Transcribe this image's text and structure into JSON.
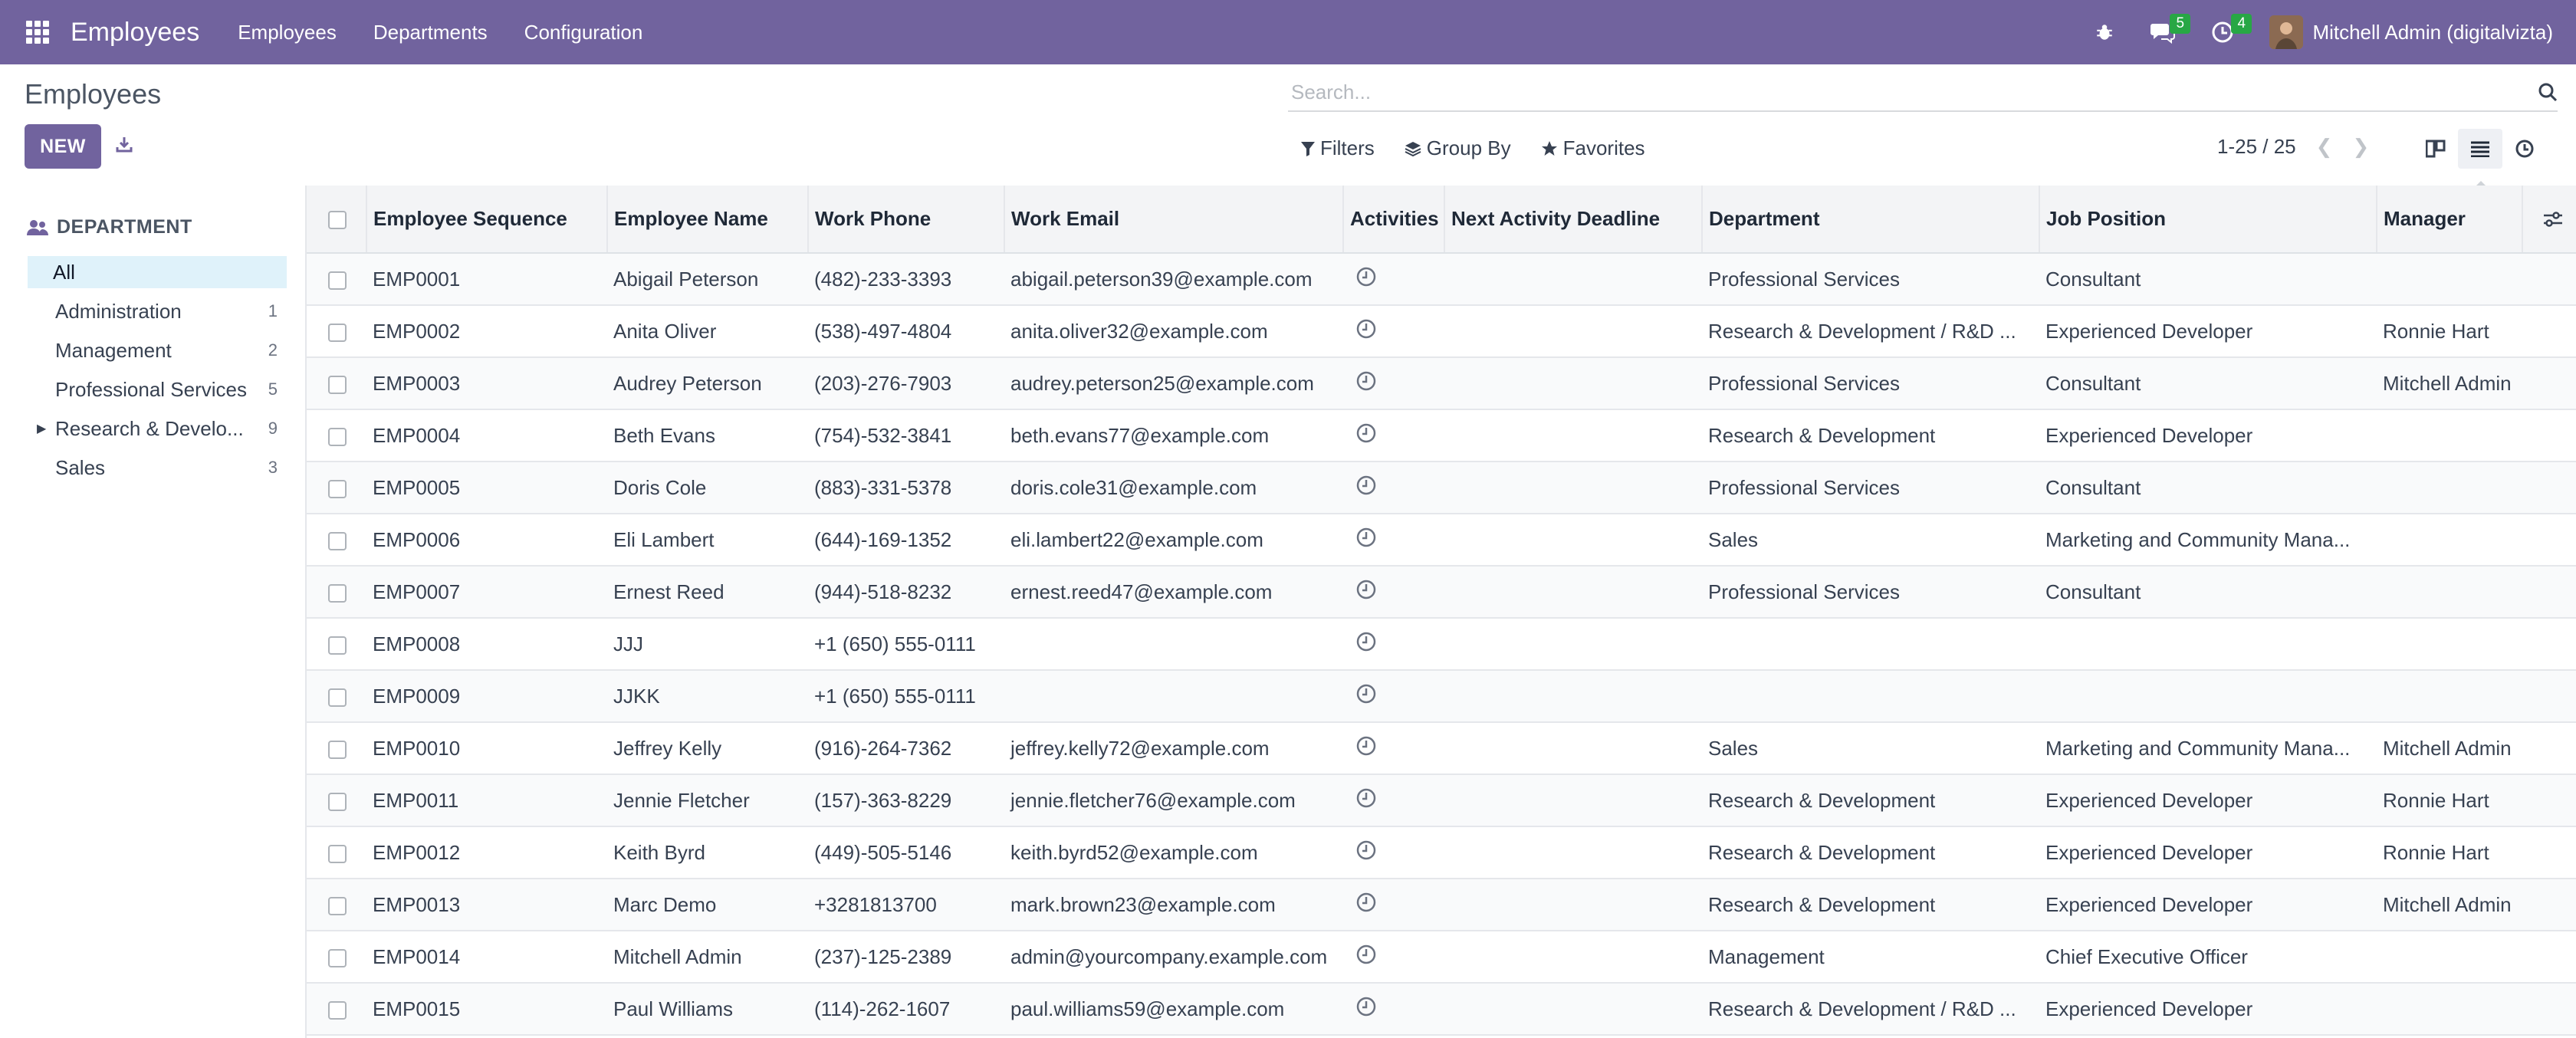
{
  "app": {
    "title": "Employees",
    "menu": [
      "Employees",
      "Departments",
      "Configuration"
    ],
    "user": "Mitchell Admin (digitalvizta)",
    "messages_badge": "5",
    "activities_badge": "4"
  },
  "control": {
    "page_title": "Employees",
    "search_placeholder": "Search...",
    "new_label": "NEW",
    "filters_label": "Filters",
    "groupby_label": "Group By",
    "favorites_label": "Favorites",
    "pager": "1-25 / 25",
    "tooltip": "List"
  },
  "sidebar": {
    "title": "DEPARTMENT",
    "items": [
      {
        "label": "All",
        "count": ""
      },
      {
        "label": "Administration",
        "count": "1"
      },
      {
        "label": "Management",
        "count": "2"
      },
      {
        "label": "Professional Services",
        "count": "5"
      },
      {
        "label": "Research & Develo...",
        "count": "9"
      },
      {
        "label": "Sales",
        "count": "3"
      }
    ]
  },
  "table": {
    "columns": [
      "Employee Sequence",
      "Employee Name",
      "Work Phone",
      "Work Email",
      "Activities",
      "Next Activity Deadline",
      "Department",
      "Job Position",
      "Manager"
    ],
    "rows": [
      {
        "seq": "EMP0001",
        "name": "Abigail Peterson",
        "phone": "(482)-233-3393",
        "email": "abigail.peterson39@example.com",
        "deadline": "",
        "dept": "Professional Services",
        "job": "Consultant",
        "manager": ""
      },
      {
        "seq": "EMP0002",
        "name": "Anita Oliver",
        "phone": "(538)-497-4804",
        "email": "anita.oliver32@example.com",
        "deadline": "",
        "dept": "Research & Development / R&D ...",
        "job": "Experienced Developer",
        "manager": "Ronnie Hart"
      },
      {
        "seq": "EMP0003",
        "name": "Audrey Peterson",
        "phone": "(203)-276-7903",
        "email": "audrey.peterson25@example.com",
        "deadline": "",
        "dept": "Professional Services",
        "job": "Consultant",
        "manager": "Mitchell Admin"
      },
      {
        "seq": "EMP0004",
        "name": "Beth Evans",
        "phone": "(754)-532-3841",
        "email": "beth.evans77@example.com",
        "deadline": "",
        "dept": "Research & Development",
        "job": "Experienced Developer",
        "manager": ""
      },
      {
        "seq": "EMP0005",
        "name": "Doris Cole",
        "phone": "(883)-331-5378",
        "email": "doris.cole31@example.com",
        "deadline": "",
        "dept": "Professional Services",
        "job": "Consultant",
        "manager": ""
      },
      {
        "seq": "EMP0006",
        "name": "Eli Lambert",
        "phone": "(644)-169-1352",
        "email": "eli.lambert22@example.com",
        "deadline": "",
        "dept": "Sales",
        "job": "Marketing and Community Mana...",
        "manager": ""
      },
      {
        "seq": "EMP0007",
        "name": "Ernest Reed",
        "phone": "(944)-518-8232",
        "email": "ernest.reed47@example.com",
        "deadline": "",
        "dept": "Professional Services",
        "job": "Consultant",
        "manager": ""
      },
      {
        "seq": "EMP0008",
        "name": "JJJ",
        "phone": "+1 (650) 555-0111",
        "email": "",
        "deadline": "",
        "dept": "",
        "job": "",
        "manager": ""
      },
      {
        "seq": "EMP0009",
        "name": "JJKK",
        "phone": "+1 (650) 555-0111",
        "email": "",
        "deadline": "",
        "dept": "",
        "job": "",
        "manager": ""
      },
      {
        "seq": "EMP0010",
        "name": "Jeffrey Kelly",
        "phone": "(916)-264-7362",
        "email": "jeffrey.kelly72@example.com",
        "deadline": "",
        "dept": "Sales",
        "job": "Marketing and Community Mana...",
        "manager": "Mitchell Admin"
      },
      {
        "seq": "EMP0011",
        "name": "Jennie Fletcher",
        "phone": "(157)-363-8229",
        "email": "jennie.fletcher76@example.com",
        "deadline": "",
        "dept": "Research & Development",
        "job": "Experienced Developer",
        "manager": "Ronnie Hart"
      },
      {
        "seq": "EMP0012",
        "name": "Keith Byrd",
        "phone": "(449)-505-5146",
        "email": "keith.byrd52@example.com",
        "deadline": "",
        "dept": "Research & Development",
        "job": "Experienced Developer",
        "manager": "Ronnie Hart"
      },
      {
        "seq": "EMP0013",
        "name": "Marc Demo",
        "phone": "+3281813700",
        "email": "mark.brown23@example.com",
        "deadline": "",
        "dept": "Research & Development",
        "job": "Experienced Developer",
        "manager": "Mitchell Admin"
      },
      {
        "seq": "EMP0014",
        "name": "Mitchell Admin",
        "phone": "(237)-125-2389",
        "email": "admin@yourcompany.example.com",
        "deadline": "",
        "dept": "Management",
        "job": "Chief Executive Officer",
        "manager": ""
      },
      {
        "seq": "EMP0015",
        "name": "Paul Williams",
        "phone": "(114)-262-1607",
        "email": "paul.williams59@example.com",
        "deadline": "",
        "dept": "Research & Development / R&D ...",
        "job": "Experienced Developer",
        "manager": ""
      }
    ]
  },
  "colors": {
    "navbar": "#71639e",
    "accent": "#71639e",
    "badge": "#28a745",
    "selected_filter": "#dff2fa"
  }
}
